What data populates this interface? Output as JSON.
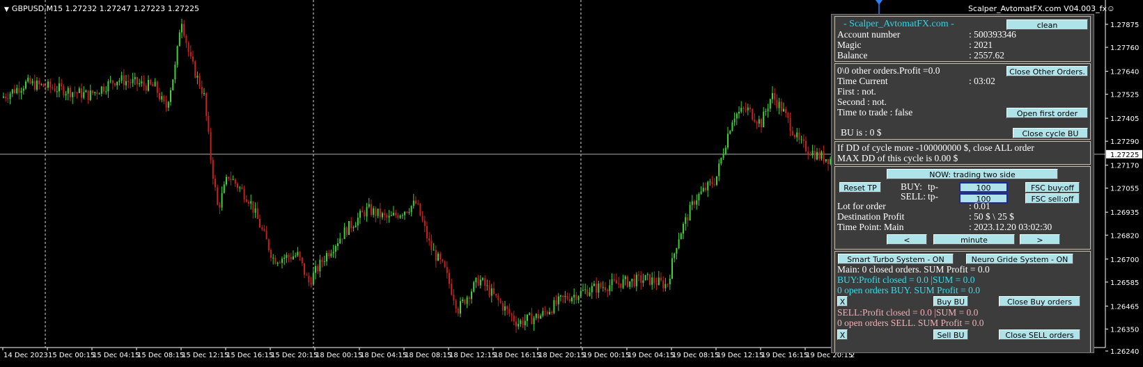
{
  "chart": {
    "symbol_line": "GBPUSD,M15  1.27232 1.27247 1.27223 1.27225",
    "ea_name": "Scalper_AvtomatFX.com  V04.003_fx",
    "smiley_icon": "smiley-icon",
    "price_levels": [
      "1.27875",
      "1.27760",
      "1.27640",
      "1.27525",
      "1.27405",
      "1.27290",
      "1.27170",
      "1.27055",
      "1.26935",
      "1.26820",
      "1.26700",
      "1.26585",
      "1.26465",
      "1.26350",
      "1.26240"
    ],
    "current_price": "1.27225",
    "time_labels": [
      "14 Dec 2023",
      "15 Dec 00:15",
      "15 Dec 04:15",
      "15 Dec 08:15",
      "15 Dec 12:15",
      "15 Dec 16:15",
      "15 Dec 20:15",
      "18 Dec 00:15",
      "18 Dec 04:15",
      "18 Dec 08:15",
      "18 Dec 12:15",
      "18 Dec 16:15",
      "18 Dec 20:15",
      "19 Dec 00:15",
      "19 Dec 04:15",
      "19 Dec 08:15",
      "19 Dec 12:15",
      "19 Dec 16:15",
      "19 Dec 20:15",
      "2"
    ],
    "colors": {
      "bull": "#3fd23a",
      "bear": "#c8201c",
      "grid": "#c8c8c8",
      "axis": "#ffffff",
      "cursor": "#2b7fff"
    }
  },
  "panel": {
    "title": "- Scalper_AvtomatFX.com -",
    "clean_button": "clean",
    "account_label": "Account number",
    "account_value": ": 500393346",
    "magic_label": "Magic",
    "magic_value": ": 2021",
    "balance_label": "Balance",
    "balance_value": ": 2557.62",
    "other_orders": "0\\0 other orders.Profit =0.0",
    "close_other_button": "Close Other Orders.",
    "time_current_label": "Time Current",
    "time_current_value": ": 03:02",
    "first_line": "First     : not.",
    "second_line": "Second  : not.",
    "time_to_trade": "Time to trade :  false",
    "open_first_button": "Open first order",
    "bu_is": "BU is :  0 $",
    "close_cycle_button": "Close cycle BU",
    "dd_line1": "If DD of cycle more -100000000 $, close ALL order",
    "dd_line2": "MAX DD of this cycle is 0.00 $",
    "now_button": "NOW: trading two side",
    "reset_tp_button": "Reset TP",
    "buy_label": "BUY:",
    "buy_tp": "tp-",
    "buy_value": "100",
    "fsc_buy_button": "FSC buy:off",
    "sell_label": "SELL:",
    "sell_tp": "tp-",
    "sell_value": "100",
    "fsc_sell_button": "FSC sell:off",
    "lot_label": "Lot for order",
    "lot_value": ": 0.01",
    "dest_label": "Destination Profit",
    "dest_value": ": 50 $ \\ 25 $",
    "timepoint_label": "Time Point: Main",
    "timepoint_value": ": 2023.12.20 03:02:30",
    "prev_button": "<",
    "minute_button": "minute",
    "next_button": ">",
    "smart_turbo_button": "Smart Turbo System - ON",
    "neuro_button": "Neuro Gride System - ON",
    "main_line": "Main: 0 closed orders. SUM Profit = 0.0",
    "buy_profit_line": "BUY:Profit closed = 0.0  |SUM = 0.0",
    "buy_open_line": "0 open orders BUY. SUM Profit = 0.0",
    "x_button": "X",
    "buy_bu_button": "Buy BU",
    "close_buy_button": "Close Buy orders",
    "sell_profit_line": "SELL:Profit closed = 0.0  |SUM = 0.0",
    "sell_open_line": "0 open orders SELL. SUM Profit = 0.0",
    "x2_button": "X",
    "sell_bu_button": "Sell BU",
    "close_sell_button": "Close SELL orders"
  }
}
